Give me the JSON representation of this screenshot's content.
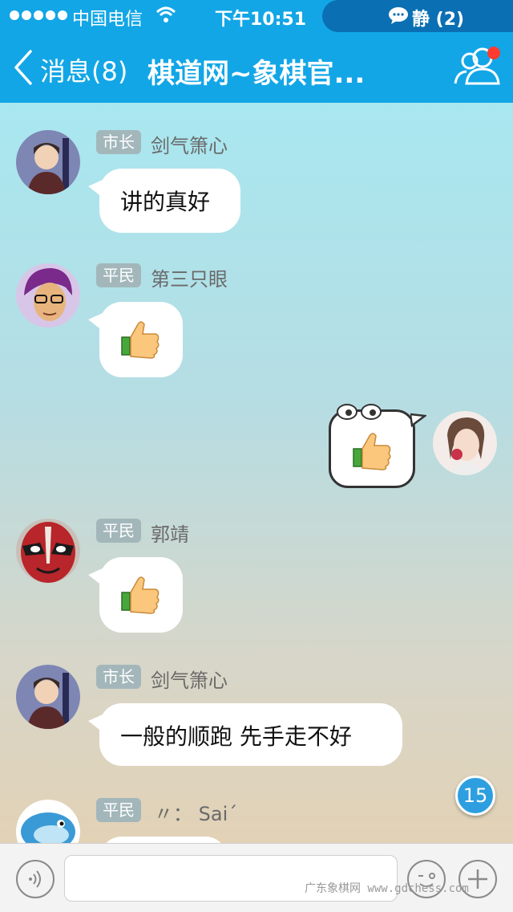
{
  "status": {
    "carrier": "中国电信",
    "time": "下午10:51",
    "notice": "静 (2)"
  },
  "nav": {
    "back_label": "消息(8)",
    "title": "棋道网~象棋官...",
    "group_icon": "group-members-icon"
  },
  "messages": [
    {
      "rank": "市长",
      "nick": "剑气箫心",
      "text": "讲的真好"
    },
    {
      "rank": "平民",
      "nick": "第三只眼",
      "icon": "thumbs-up-icon"
    },
    {
      "self": true,
      "icon": "thumbs-up-icon"
    },
    {
      "rank": "平民",
      "nick": "郭靖",
      "icon": "thumbs-up-icon"
    },
    {
      "rank": "市长",
      "nick": "剑气箫心",
      "text": "一般的顺跑 先手走不好"
    },
    {
      "rank": "平民",
      "nick": "〃： Sai´"
    }
  ],
  "unread_count": "15",
  "watermark": "广东象棋网 www.gdchess.com",
  "colors": {
    "nav": "#12a6e6",
    "rank_badge": "#a3b7bb",
    "unread": "#2d9fe0"
  }
}
